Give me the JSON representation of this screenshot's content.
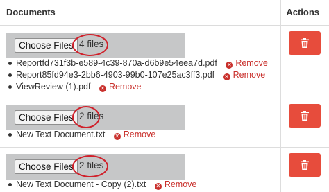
{
  "header": {
    "documents": "Documents",
    "actions": "Actions"
  },
  "rows": [
    {
      "choose_label": "Choose Files",
      "file_count": "4 files",
      "files": [
        {
          "name": "Reportfd731f3b-e589-4c39-870a-d6b9e54eea7d.pdf",
          "remove": "Remove"
        },
        {
          "name": "Report85fd94e3-2bb6-4903-99b0-107e25ac3ff3.pdf",
          "remove": "Remove"
        },
        {
          "name": "ViewReview (1).pdf",
          "remove": "Remove"
        }
      ]
    },
    {
      "choose_label": "Choose Files",
      "file_count": "2 files",
      "files": [
        {
          "name": "New Text Document.txt",
          "remove": "Remove"
        }
      ]
    },
    {
      "choose_label": "Choose Files",
      "file_count": "2 files",
      "files": [
        {
          "name": "New Text Document - Copy (2).txt",
          "remove": "Remove"
        }
      ]
    }
  ],
  "icons": {
    "delete": "trash-icon",
    "remove": "remove-circle-x-icon"
  },
  "colors": {
    "delete_button": "#e74c3c",
    "remove_link": "#c9302c",
    "annotation_circle": "#d0202a",
    "picker_bg": "#c6c7c8"
  }
}
